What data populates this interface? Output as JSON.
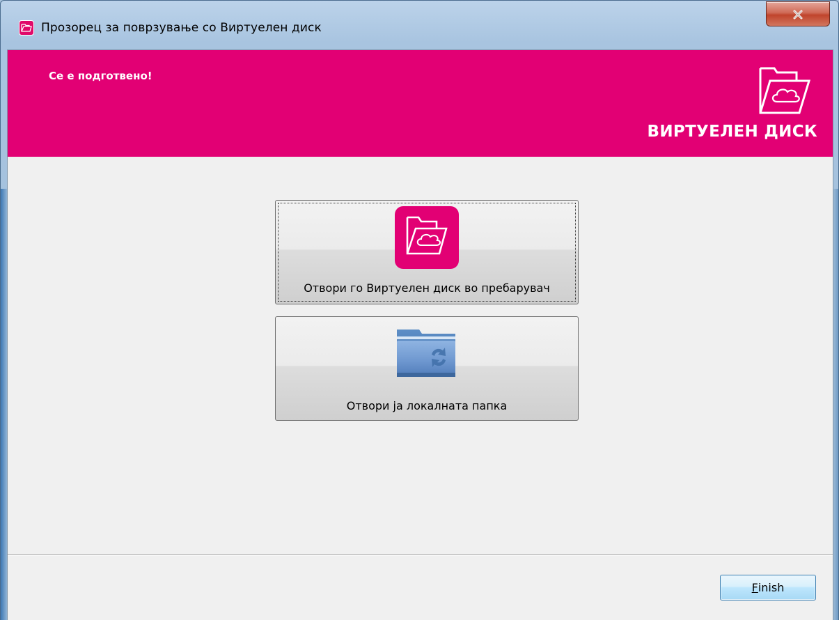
{
  "window": {
    "title": "Прозорец за поврзување со Виртуелен диск",
    "close_label": "x"
  },
  "banner": {
    "heading": "Се е подготвено!",
    "brand_name": "ВИРТУЕЛЕН ДИСК",
    "color": "#e20074"
  },
  "actions": [
    {
      "label": "Отвори го Виртуелен диск во пребарувач",
      "icon": "virtual-disk-icon"
    },
    {
      "label": "Отвори ја локалната папка",
      "icon": "sync-folder-icon"
    }
  ],
  "footer": {
    "finish_mnemonic": "F",
    "finish_rest": "inish"
  }
}
